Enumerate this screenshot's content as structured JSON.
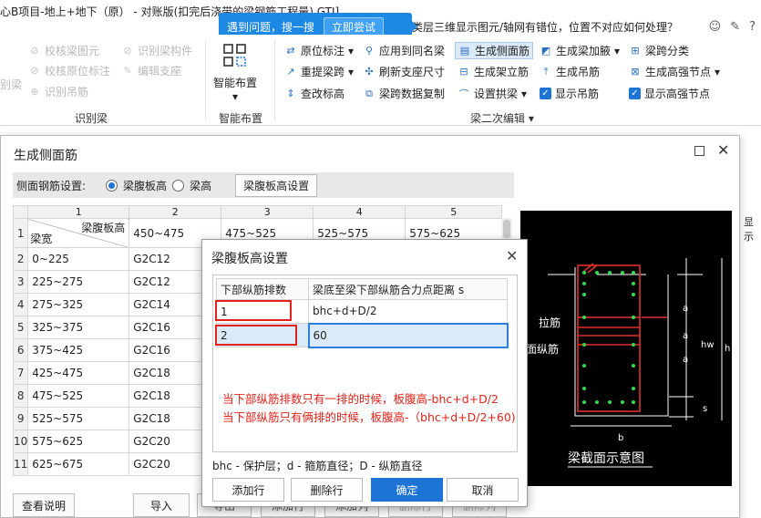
{
  "window": {
    "title": "心B项目-地上+地下（原） - 对账版(扣完后浇带的梁钢筋工程量) GTJ]",
    "question": "类层三维显示图元/轴网有错位，位置不对应如何处理？",
    "tip_text": "遇到问题，搜一搜",
    "tip_button": "立即尝试"
  },
  "ribbon": {
    "identify": {
      "left_cut": "别梁",
      "check_beam": "校核梁图元",
      "check_support": "校核原位标注",
      "identify_rebar": "识别吊筋",
      "identify_component": "识别梁构件",
      "edit_support": "编辑支座",
      "group_label": "识别梁"
    },
    "smart": {
      "label": "智能布置",
      "group_label": "智能布置"
    },
    "edit": {
      "row1": [
        "原位标注",
        "应用到同名梁",
        "生成侧面筋",
        "生成梁加腋",
        "梁跨分类"
      ],
      "row2": [
        "重提梁跨",
        "刷新支座尺寸",
        "生成架立筋",
        "生成吊筋",
        "生成高强节点"
      ],
      "row3": [
        "查改标高",
        "梁跨数据复制",
        "设置拱梁",
        "显示吊筋",
        "显示高强节点"
      ],
      "group_label": "梁二次编辑"
    }
  },
  "dialog_side": {
    "title": "生成侧面筋",
    "setting_label": "侧面钢筋设置:",
    "radio_web": "梁腹板高",
    "radio_height": "梁高",
    "web_setting_button": "梁腹板高设置",
    "grid": {
      "col_numbers": [
        "1",
        "2",
        "3",
        "4",
        "5"
      ],
      "corner_top": "梁腹板高",
      "corner_bottom": "梁宽",
      "header_ranges": [
        "450~475",
        "475~525",
        "525~575",
        "575~625"
      ],
      "rows": [
        {
          "num": "2",
          "width": "0~225",
          "val": "G2C12"
        },
        {
          "num": "3",
          "width": "225~275",
          "val": "G2C12"
        },
        {
          "num": "4",
          "width": "275~325",
          "val": "G2C14"
        },
        {
          "num": "5",
          "width": "325~375",
          "val": "G2C16"
        },
        {
          "num": "6",
          "width": "375~425",
          "val": "G2C16"
        },
        {
          "num": "7",
          "width": "425~475",
          "val": "G2C18"
        },
        {
          "num": "8",
          "width": "475~525",
          "val": "G2C18"
        },
        {
          "num": "9",
          "width": "525~575",
          "val": "G2C18"
        },
        {
          "num": "10",
          "width": "575~625",
          "val": "G2C20"
        },
        {
          "num": "11",
          "width": "625~675",
          "val": "G2C20"
        }
      ]
    },
    "footer": {
      "view_help": "查看说明",
      "import": "导入",
      "export_cut": "导出",
      "add_row_cut": "添加行",
      "add_col_cut": "添加列",
      "del_row_cut": "删除行",
      "del_col_cut": "删除列"
    },
    "diagram": {
      "label_tie": "拉筋",
      "label_side": "侧面纵筋",
      "caption": "梁截面示意图",
      "dim_a": "a",
      "dim_hw": "hw",
      "dim_h": "h",
      "dim_s": "s",
      "dim_b": "b"
    }
  },
  "dialog_web": {
    "title": "梁腹板高设置",
    "col1": "下部纵筋排数",
    "col2": "梁底至梁下部纵筋合力点距离 s",
    "rows": [
      {
        "count": "1",
        "distance": "bhc+d+D/2"
      },
      {
        "count": "2",
        "distance": "60"
      }
    ],
    "note1": "当下部纵筋排数只有一排的时候，板腹高-bhc+d+D/2",
    "note2": "当下部纵筋只有俩排的时候，板腹高-（bhc+d+D/2+60)",
    "legend": "bhc - 保护层；d - 箍筋直径；D - 纵筋直径",
    "buttons": {
      "add_row": "添加行",
      "del_row": "删除行",
      "ok": "确定",
      "cancel": "取消"
    }
  },
  "right_cut": {
    "label": "显示"
  }
}
